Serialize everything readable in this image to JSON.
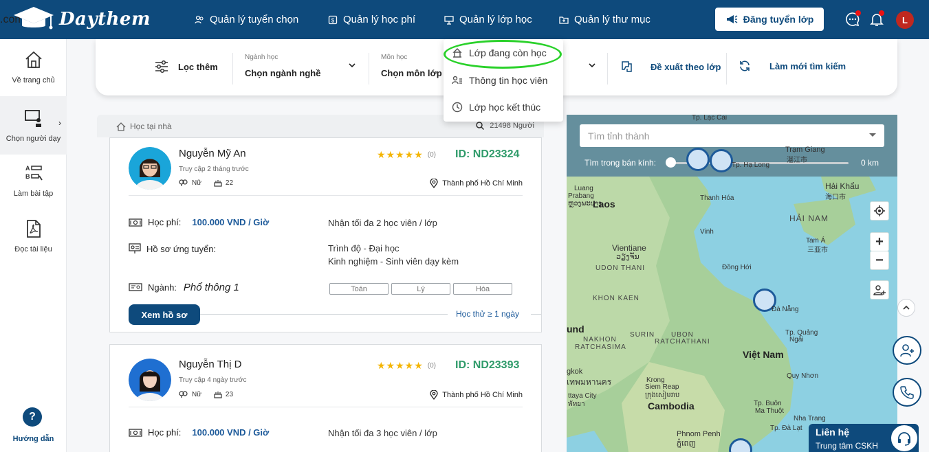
{
  "header": {
    "logo_text": "Daythem",
    "logo_suffix": ".com",
    "nav": [
      {
        "label": "Quản lý tuyển chọn"
      },
      {
        "label": "Quản lý học phí"
      },
      {
        "label": "Quản lý lớp học"
      },
      {
        "label": "Quản lý thư mục"
      }
    ],
    "post_button": "Đăng tuyển lớp",
    "avatar_initial": "L"
  },
  "sidebar": {
    "items": [
      {
        "label": "Về trang chủ"
      },
      {
        "label": "Chọn người dạy"
      },
      {
        "label": "Làm bài tập"
      },
      {
        "label": "Đọc tài liệu"
      }
    ],
    "help_glyph": "?",
    "help_label": "Hướng dẫn",
    "active_arrow": "›"
  },
  "filterbar": {
    "more_filter": "Lọc thêm",
    "major": {
      "label": "Ngành học",
      "value": "Chọn ngành nghề"
    },
    "subject": {
      "label": "Môn học",
      "value": "Chọn môn lớp"
    },
    "suggest": "Đề xuất theo lớp",
    "refresh": "Làm mới tìm kiếm"
  },
  "dropdown": {
    "items": [
      {
        "label": "Lớp đang còn học"
      },
      {
        "label": "Thông tin học viên"
      },
      {
        "label": "Lớp học kết thúc"
      }
    ]
  },
  "list": {
    "category": "Học tại nhà",
    "count": "21498 Người"
  },
  "tutors": [
    {
      "name": "Nguyễn Mỹ An",
      "access": "Truy cập 2 tháng trước",
      "gender": "Nữ",
      "age": "22",
      "stars": "★★★★★",
      "rating_count": "(0)",
      "id": "ID: ND23324",
      "city": "Thành phố Hồ Chí Minh",
      "fee_label": "Học phí:",
      "fee": "100.000 VND / Giờ",
      "capacity": "Nhận tối đa 2 học viên / lớp",
      "profile_label": "Hồ sơ ứng tuyển:",
      "level": "Trình độ - Đại học",
      "experience": "Kinh nghiệm - Sinh viên dạy kèm",
      "major_label": "Ngành:",
      "major": "Phổ thông 1",
      "subjects": [
        "Toán",
        "Lý",
        "Hóa"
      ],
      "view_button": "Xem hồ sơ",
      "trial": "Học thử ≥ 1 ngày"
    },
    {
      "name": "Nguyễn Thị D",
      "access": "Truy cập 4 ngày trước",
      "gender": "Nữ",
      "age": "23",
      "stars": "★★★★★",
      "rating_count": "(0)",
      "id": "ID: ND23393",
      "city": "Thành phố Hồ Chí Minh",
      "fee_label": "Học phí:",
      "fee": "100.000 VND / Giờ",
      "capacity": "Nhận tối đa 3 học viên / lớp"
    }
  ],
  "map": {
    "search_placeholder": "Tìm tỉnh thành",
    "radius_label": "Tìm trong bán kính:",
    "radius_value": "0 km",
    "zoom_in": "+",
    "zoom_out": "−",
    "labels": [
      {
        "text": "Tp. Lạc Cai"
      },
      {
        "text": "Trạm Giang"
      },
      {
        "text": "湛江市"
      },
      {
        "text": "Tp. Hạ Long"
      },
      {
        "text": "Luang"
      },
      {
        "text": "Prabang"
      },
      {
        "text": "ຫຼວງພະບາງ"
      },
      {
        "text": "Laos"
      },
      {
        "text": "Thanh Hóa"
      },
      {
        "text": "Hải Khẩu"
      },
      {
        "text": "海口市"
      },
      {
        "text": "HẢI NAM"
      },
      {
        "text": "Vinh"
      },
      {
        "text": "Tam Á"
      },
      {
        "text": "三亚市"
      },
      {
        "text": "Vientiane"
      },
      {
        "text": "ວຽງຈັນ"
      },
      {
        "text": "UDON THANI"
      },
      {
        "text": "Đồng Hới"
      },
      {
        "text": "KHON KAEN"
      },
      {
        "text": "Đà Nẵng"
      },
      {
        "text": "Tp. Quảng"
      },
      {
        "text": "Ngãi"
      },
      {
        "text": "und"
      },
      {
        "text": "SURIN"
      },
      {
        "text": "UBON"
      },
      {
        "text": "RATCHATHANI"
      },
      {
        "text": "NAKHON"
      },
      {
        "text": "RATCHASIMA"
      },
      {
        "text": "Việt Nam"
      },
      {
        "text": "gkok"
      },
      {
        "text": "เทพมหานคร"
      },
      {
        "text": "Quy Nhơn"
      },
      {
        "text": "Krong"
      },
      {
        "text": "Siem Reap"
      },
      {
        "text": "ក្រុងសៀមរាប"
      },
      {
        "text": "ttaya City"
      },
      {
        "text": "พัทยา"
      },
      {
        "text": "Cambodia"
      },
      {
        "text": "Tp. Buôn"
      },
      {
        "text": "Ma Thuột"
      },
      {
        "text": "Nha Trang"
      },
      {
        "text": "Tp. Đà Lạt"
      },
      {
        "text": "Phnom Penh"
      },
      {
        "text": "ភ្នំពេញ"
      }
    ]
  },
  "contact": {
    "title": "Liên hệ",
    "subtitle": "Trung tâm CSKH"
  },
  "colors": {
    "primary": "#0e4a7c",
    "id_green": "#2f9b6a",
    "star": "#f4b400",
    "highlight": "#2ad12a"
  }
}
